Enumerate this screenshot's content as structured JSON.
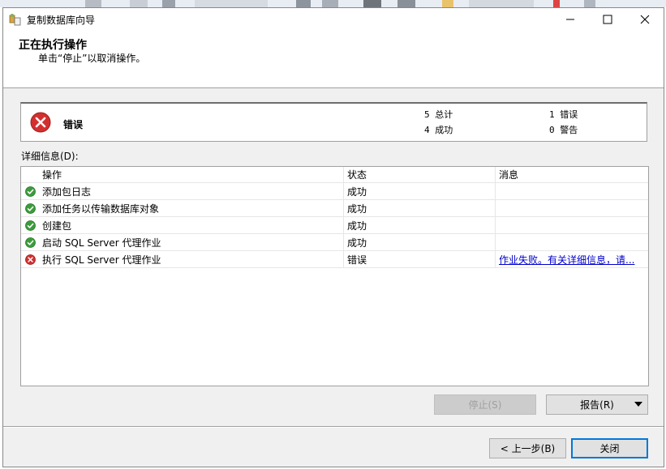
{
  "window": {
    "title": "复制数据库向导",
    "min_icon": "minimize-icon",
    "max_icon": "maximize-icon",
    "close_icon": "close-icon"
  },
  "header": {
    "title": "正在执行操作",
    "subtitle": "单击“停止”以取消操作。"
  },
  "summary": {
    "status_label": "错误",
    "status_icon": "error-icon",
    "total": "5 总计",
    "success": "4 成功",
    "errors": "1 错误",
    "warnings": "0 警告"
  },
  "details": {
    "label": "详细信息(D):",
    "columns": {
      "operation": "操作",
      "status": "状态",
      "message": "消息"
    },
    "rows": [
      {
        "icon": "success-icon",
        "operation": "添加包日志",
        "status": "成功",
        "message": ""
      },
      {
        "icon": "success-icon",
        "operation": "添加任务以传输数据库对象",
        "status": "成功",
        "message": ""
      },
      {
        "icon": "success-icon",
        "operation": "创建包",
        "status": "成功",
        "message": ""
      },
      {
        "icon": "success-icon",
        "operation": "启动 SQL Server 代理作业",
        "status": "成功",
        "message": ""
      },
      {
        "icon": "error-icon",
        "operation": "执行 SQL Server 代理作业",
        "status": "错误",
        "message": "作业失败。有关详细信息，请..."
      }
    ]
  },
  "buttons": {
    "stop": "停止(S)",
    "report": "报告(R)",
    "back": "< 上一步(B)",
    "close": "关闭"
  },
  "colors": {
    "success": "#3c9b3c",
    "error": "#d32f2f",
    "link": "#0000cc",
    "focus_border": "#0078d7"
  }
}
